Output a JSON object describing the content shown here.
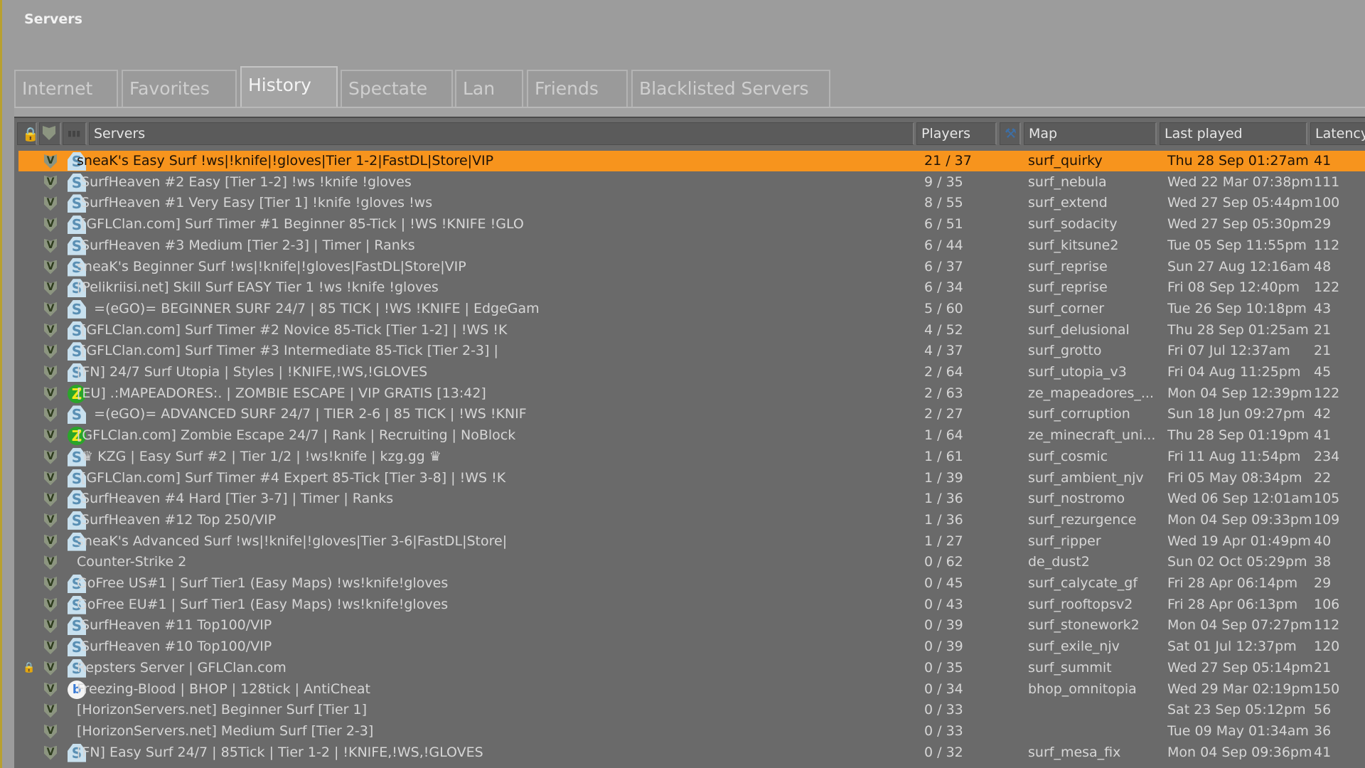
{
  "window": {
    "title": "Servers"
  },
  "tabs": [
    {
      "label": "Internet"
    },
    {
      "label": "Favorites"
    },
    {
      "label": "History",
      "active": true
    },
    {
      "label": "Spectate"
    },
    {
      "label": "Lan"
    },
    {
      "label": "Friends"
    },
    {
      "label": "Blacklisted Servers"
    }
  ],
  "columns": {
    "lock": "lock-icon",
    "secure": "shield-icon",
    "bots": "bots-icon",
    "servers": "Servers",
    "players": "Players",
    "map_icon": "wrench-icon",
    "map": "Map",
    "last_played": "Last played",
    "latency": "Latency"
  },
  "colors": {
    "selected": "#f7941d",
    "list_bg": "#6a6a6a"
  },
  "rows": [
    {
      "name": "sneaK's Easy Surf !ws|!knife|!gloves|Tier 1-2|FastDL|Store|VIP",
      "icon": "s",
      "players": "21 / 37",
      "map": "surf_quirky",
      "last": "Thu 28 Sep 01:27am",
      "latency": "41",
      "selected": true
    },
    {
      "name": " SurfHeaven #2 Easy [Tier 1-2] !ws !knife !gloves",
      "icon": "s",
      "players": "9 / 35",
      "map": "surf_nebula",
      "last": "Wed 22 Mar 07:38pm",
      "latency": "111"
    },
    {
      "name": " SurfHeaven #1 Very Easy [Tier 1] !knife !gloves !ws",
      "icon": "s",
      "players": "8 / 55",
      "map": "surf_extend",
      "last": "Wed 27 Sep 05:44pm",
      "latency": "100"
    },
    {
      "name": " [GFLClan.com] Surf Timer #1 Beginner 85-Tick | !WS !KNIFE !GLO",
      "icon": "s",
      "players": "6 / 51",
      "map": "surf_sodacity",
      "last": "Wed 27 Sep 05:30pm",
      "latency": "29"
    },
    {
      "name": " SurfHeaven #3 Medium [Tier 2-3] | Timer | Ranks",
      "icon": "s",
      "players": "6 / 44",
      "map": "surf_kitsune2",
      "last": "Tue 05 Sep 11:55pm",
      "latency": "112"
    },
    {
      "name": "sneaK's Beginner Surf !ws|!knife|!gloves|FastDL|Store|VIP",
      "icon": "s",
      "players": "6 / 37",
      "map": "surf_reprise",
      "last": "Sun 27 Aug 12:16am",
      "latency": "48"
    },
    {
      "name": "[Pelikriisi.net] Skill Surf EASY Tier 1 !ws !knife !gloves",
      "icon": "s",
      "players": "6 / 34",
      "map": "surf_reprise",
      "last": "Fri 08 Sep 12:40pm",
      "latency": "122"
    },
    {
      "name": "    =(eGO)= BEGINNER SURF 24/7 | 85 TICK | !WS !KNIFE | EdgeGam",
      "icon": "s",
      "players": "5 / 60",
      "map": "surf_corner",
      "last": "Tue 26 Sep 10:18pm",
      "latency": "43"
    },
    {
      "name": " [GFLClan.com] Surf Timer #2 Novice 85-Tick [Tier 1-2] | !WS !K",
      "icon": "s",
      "players": "4 / 52",
      "map": "surf_delusional",
      "last": "Thu 28 Sep 01:25am",
      "latency": "21"
    },
    {
      "name": " [GFLClan.com] Surf Timer #3 Intermediate 85-Tick [Tier 2-3] |",
      "icon": "s",
      "players": "4 / 37",
      "map": "surf_grotto",
      "last": "Fri 07 Jul 12:37am",
      "latency": "21"
    },
    {
      "name": "[FN] 24/7 Surf Utopia | Styles | !KNIFE,!WS,!GLOVES",
      "icon": "s",
      "players": "2 / 64",
      "map": "surf_utopia_v3",
      "last": "Fri 04 Aug 11:25pm",
      "latency": "45"
    },
    {
      "name": "[EU] .:MAPEADORES:. | ZOMBIE ESCAPE | VIP GRATIS [13:42]",
      "icon": "z",
      "players": "2 / 63",
      "map": "ze_mapeadores_...",
      "last": "Mon 04 Sep 12:39pm",
      "latency": "122"
    },
    {
      "name": "    =(eGO)= ADVANCED SURF 24/7 | TIER 2-6 | 85 TICK | !WS !KNIF",
      "icon": "s",
      "players": "2 / 27",
      "map": "surf_corruption",
      "last": "Sun 18 Jun 09:27pm",
      "latency": "42"
    },
    {
      "name": "[GFLClan.com] Zombie Escape 24/7 | Rank | Recruiting | NoBlock",
      "icon": "z",
      "players": "1 / 64",
      "map": "ze_minecraft_uni...",
      "last": "Thu 28 Sep 01:19pm",
      "latency": "41"
    },
    {
      "name": " ♛ KZG | Easy Surf #2 | Tier 1/2 | !ws!knife | kzg.gg ♛",
      "icon": "s",
      "players": "1 / 61",
      "map": "surf_cosmic",
      "last": "Fri 11 Aug 11:54pm",
      "latency": "234"
    },
    {
      "name": " [GFLClan.com] Surf Timer #4 Expert 85-Tick [Tier 3-8] | !WS !K",
      "icon": "s",
      "players": "1 / 39",
      "map": "surf_ambient_njv",
      "last": "Fri 05 May 08:34pm",
      "latency": "22"
    },
    {
      "name": " SurfHeaven #4 Hard [Tier 3-7] | Timer | Ranks",
      "icon": "s",
      "players": "1 / 36",
      "map": "surf_nostromo",
      "last": "Wed 06 Sep 12:01am",
      "latency": "105"
    },
    {
      "name": " SurfHeaven #12 Top 250/VIP",
      "icon": "s",
      "players": "1 / 36",
      "map": "surf_rezurgence",
      "last": "Mon 04 Sep 09:33pm",
      "latency": "109"
    },
    {
      "name": "sneaK's Advanced Surf !ws|!knife|!gloves|Tier 3-6|FastDL|Store|",
      "icon": "s",
      "players": "1 / 27",
      "map": "surf_ripper",
      "last": "Wed 19 Apr 01:49pm",
      "latency": "40"
    },
    {
      "name": "Counter-Strike 2",
      "icon": "",
      "players": "0 / 62",
      "map": "de_dust2",
      "last": "Sun 02 Oct 05:29pm",
      "latency": "38"
    },
    {
      "name": "GoFree US#1 | Surf Tier1 (Easy Maps) !ws!knife!gloves",
      "icon": "s",
      "players": "0 / 45",
      "map": "surf_calycate_gf",
      "last": "Fri 28 Apr 06:14pm",
      "latency": "29"
    },
    {
      "name": "GoFree EU#1 | Surf Tier1 (Easy Maps) !ws!knife!gloves",
      "icon": "s",
      "players": "0 / 43",
      "map": "surf_rooftopsv2",
      "last": "Fri 28 Apr 06:13pm",
      "latency": "106"
    },
    {
      "name": " SurfHeaven #11 Top100/VIP",
      "icon": "s",
      "players": "0 / 39",
      "map": "surf_stonework2",
      "last": "Mon 04 Sep 07:27pm",
      "latency": "112"
    },
    {
      "name": " SurfHeaven #10 Top100/VIP",
      "icon": "s",
      "players": "0 / 39",
      "map": "surf_exile_njv",
      "last": "Sat 01 Jul 12:37pm",
      "latency": "120"
    },
    {
      "name": "Repsters Server | GFLClan.com",
      "icon": "s",
      "players": "0 / 35",
      "map": "surf_summit",
      "last": "Wed 27 Sep 05:14pm",
      "latency": "21",
      "locked": true
    },
    {
      "name": "Freezing-Blood | BHOP | 128tick | AntiCheat",
      "icon": "b",
      "players": "0 / 34",
      "map": "bhop_omnitopia",
      "last": "Wed 29 Mar 02:19pm",
      "latency": "150"
    },
    {
      "name": "[HorizonServers.net] Beginner Surf [Tier 1]",
      "icon": "",
      "players": "0 / 33",
      "map": "",
      "last": "Sat 23 Sep 05:12pm",
      "latency": "56"
    },
    {
      "name": "[HorizonServers.net] Medium Surf [Tier 2-3]",
      "icon": "",
      "players": "0 / 33",
      "map": "",
      "last": "Tue 09 May 01:34am",
      "latency": "36"
    },
    {
      "name": "[FN] Easy Surf 24/7 | 85Tick | Tier 1-2 | !KNIFE,!WS,!GLOVES",
      "icon": "s",
      "players": "0 / 32",
      "map": "surf_mesa_fix",
      "last": "Mon 04 Sep 09:36pm",
      "latency": "41"
    }
  ]
}
